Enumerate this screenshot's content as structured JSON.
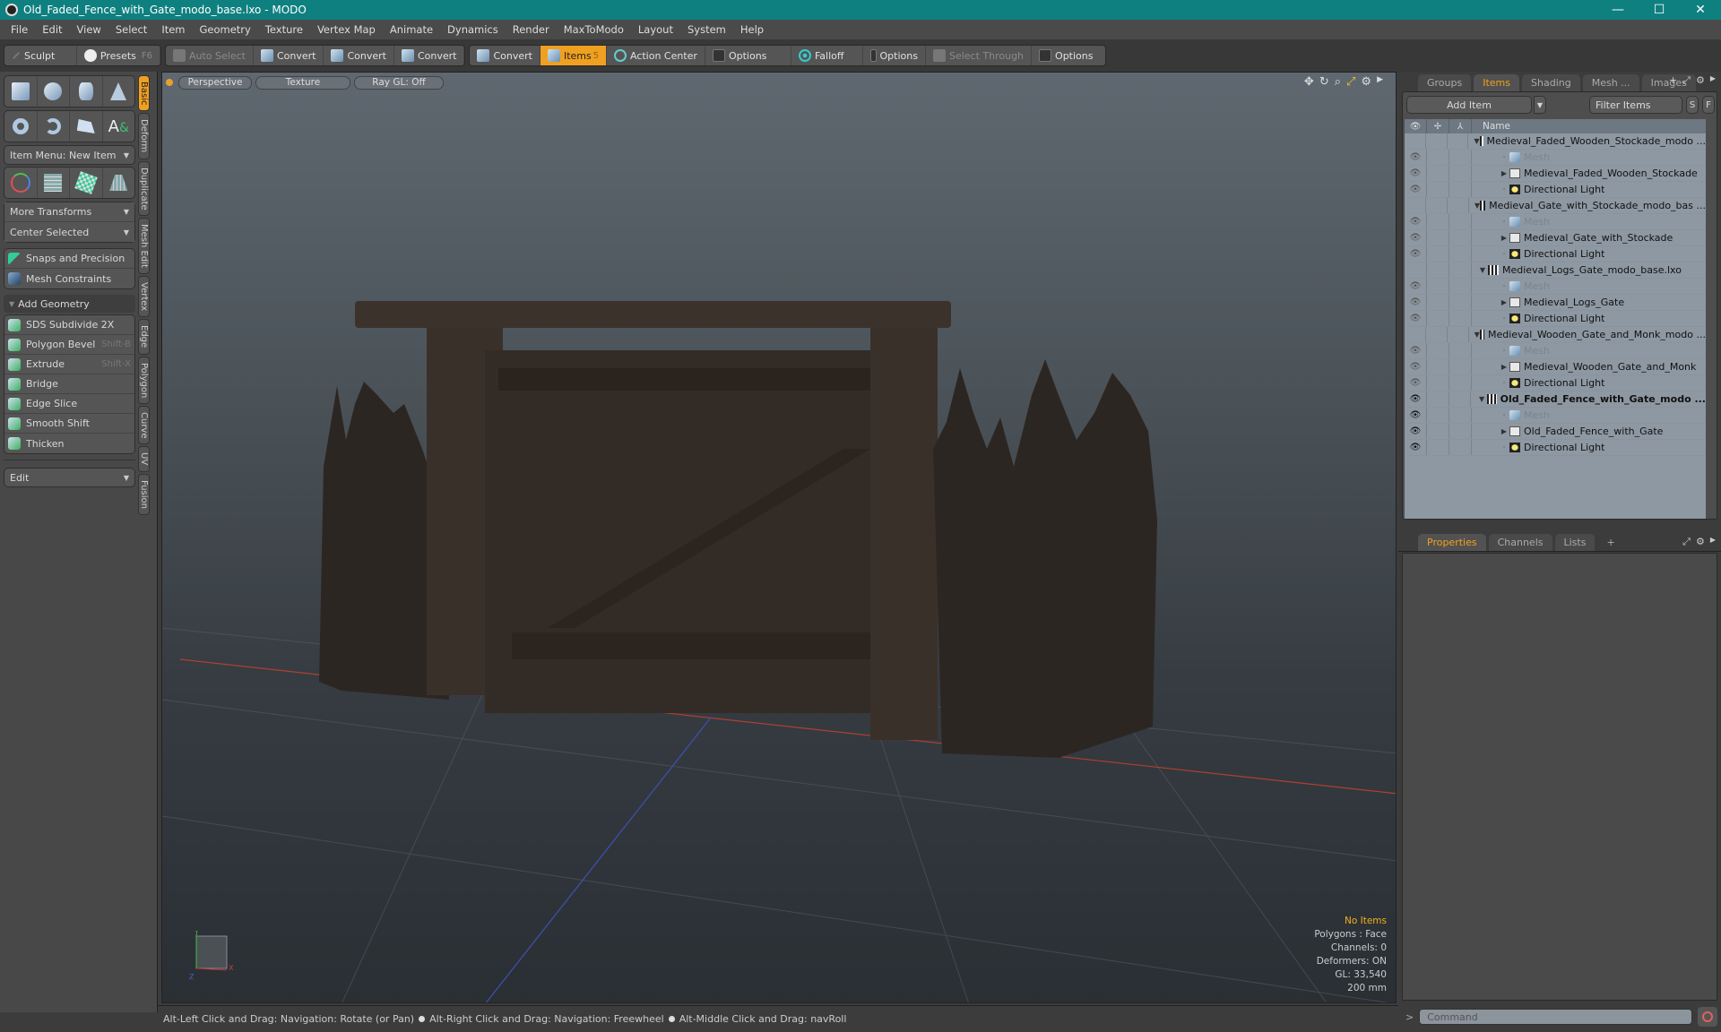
{
  "window": {
    "title": "Old_Faded_Fence_with_Gate_modo_base.lxo - MODO",
    "controls": [
      "—",
      "☐",
      "✕"
    ]
  },
  "menu": [
    "File",
    "Edit",
    "View",
    "Select",
    "Item",
    "Geometry",
    "Texture",
    "Vertex Map",
    "Animate",
    "Dynamics",
    "Render",
    "MaxToModo",
    "Layout",
    "System",
    "Help"
  ],
  "toolbar": {
    "sculpt": "Sculpt",
    "presets": "Presets",
    "presets_key": "F6",
    "auto_select": "Auto Select",
    "convert1": "Convert",
    "convert2": "Convert",
    "convert3": "Convert",
    "convert4": "Convert",
    "items": "Items",
    "items_key": "5",
    "action_center": "Action Center",
    "options1": "Options",
    "falloff": "Falloff",
    "options2": "Options",
    "select_through": "Select Through",
    "options3": "Options"
  },
  "left_panel": {
    "item_menu": "Item Menu: New Item",
    "more_transforms": "More Transforms",
    "center_selected": "Center Selected",
    "snaps": "Snaps and Precision",
    "mesh_constraints": "Mesh Constraints",
    "add_geometry": "Add Geometry",
    "tools": [
      {
        "label": "SDS Subdivide 2X",
        "key": ""
      },
      {
        "label": "Polygon Bevel",
        "key": "Shift-B"
      },
      {
        "label": "Extrude",
        "key": "Shift-X"
      },
      {
        "label": "Bridge",
        "key": ""
      },
      {
        "label": "Edge Slice",
        "key": ""
      },
      {
        "label": "Smooth Shift",
        "key": ""
      },
      {
        "label": "Thicken",
        "key": ""
      }
    ],
    "edit": "Edit",
    "vtabs": [
      "Basic",
      "Deform",
      "Duplicate",
      "Mesh Edit",
      "Vertex",
      "Edge",
      "Polygon",
      "Curve",
      "UV",
      "Fusion"
    ]
  },
  "viewport": {
    "view": "Perspective",
    "shading": "Texture",
    "raygl": "Ray GL: Off",
    "info": {
      "items": "No Items",
      "polygons": "Polygons : Face",
      "channels": "Channels: 0",
      "deformers": "Deformers: ON",
      "gl": "GL: 33,540",
      "scale": "200 mm"
    },
    "axes": {
      "x": "X",
      "y": "Y",
      "z": "Z"
    }
  },
  "status": {
    "hint1": "Alt-Left Click and Drag: Navigation: Rotate (or Pan)",
    "hint2": "Alt-Right Click and Drag: Navigation: Freewheel",
    "hint3": "Alt-Middle Click and Drag: navRoll"
  },
  "right_panel": {
    "tabs": [
      "Groups",
      "Items",
      "Shading",
      "Mesh ...",
      "Images"
    ],
    "add_item": "Add Item",
    "filter": "Filter Items",
    "s": "S",
    "f": "F",
    "name_header": "Name",
    "tree": [
      {
        "type": "scene",
        "name": "Medieval_Faded_Wooden_Stockade_modo ...",
        "eye": false,
        "bold": false
      },
      {
        "type": "mesh",
        "name": "Mesh",
        "eye": true,
        "bold": false
      },
      {
        "type": "folder",
        "name": "Medieval_Faded_Wooden_Stockade",
        "eye": true,
        "bold": false
      },
      {
        "type": "light",
        "name": "Directional Light",
        "eye": true,
        "bold": false
      },
      {
        "type": "scene",
        "name": "Medieval_Gate_with_Stockade_modo_bas ...",
        "eye": false,
        "bold": false
      },
      {
        "type": "mesh",
        "name": "Mesh",
        "eye": true,
        "bold": false
      },
      {
        "type": "folder",
        "name": "Medieval_Gate_with_Stockade",
        "eye": true,
        "bold": false
      },
      {
        "type": "light",
        "name": "Directional Light",
        "eye": true,
        "bold": false
      },
      {
        "type": "scene",
        "name": "Medieval_Logs_Gate_modo_base.lxo",
        "eye": false,
        "bold": false
      },
      {
        "type": "mesh",
        "name": "Mesh",
        "eye": true,
        "bold": false
      },
      {
        "type": "folder",
        "name": "Medieval_Logs_Gate",
        "eye": true,
        "bold": false
      },
      {
        "type": "light",
        "name": "Directional Light",
        "eye": true,
        "bold": false
      },
      {
        "type": "scene",
        "name": "Medieval_Wooden_Gate_and_Monk_modo ...",
        "eye": false,
        "bold": false
      },
      {
        "type": "mesh",
        "name": "Mesh",
        "eye": true,
        "bold": false
      },
      {
        "type": "folder",
        "name": "Medieval_Wooden_Gate_and_Monk",
        "eye": true,
        "bold": false
      },
      {
        "type": "light",
        "name": "Directional Light",
        "eye": true,
        "bold": false
      },
      {
        "type": "scene",
        "name": "Old_Faded_Fence_with_Gate_modo ...",
        "eye": true,
        "bold": true
      },
      {
        "type": "mesh",
        "name": "Mesh",
        "eye": true,
        "bold": false
      },
      {
        "type": "folder",
        "name": "Old_Faded_Fence_with_Gate",
        "eye": true,
        "bold": false
      },
      {
        "type": "light",
        "name": "Directional Light",
        "eye": true,
        "bold": false
      }
    ],
    "props_tabs": [
      "Properties",
      "Channels",
      "Lists"
    ],
    "command_placeholder": "Command"
  },
  "colors": {
    "accent": "#f0a020",
    "titlebar": "#0f8080"
  }
}
